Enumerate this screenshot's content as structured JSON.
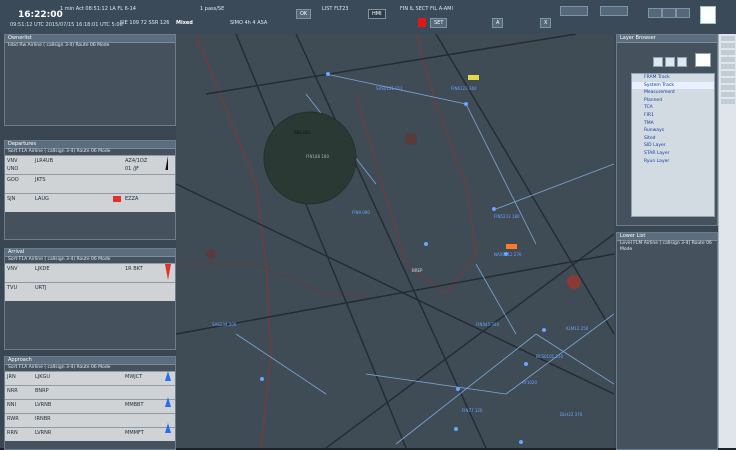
{
  "topbar": {
    "time": "16:22:00",
    "date": "09:51:12 UTC 2015/07/15 16:18:01 UTC 5:06",
    "group1a": "1 min Act   08:51:12  LA FL 6-14",
    "group1b": "SIE 109 72   SSR 126",
    "group1c": "Mixed",
    "group2a": "1 pass/SE   ",
    "group2b": "SIMO   4h  4 ASA",
    "group3a": "LIST FLT23",
    "group3b": "HMI",
    "group4a": "FIN   IL   SECT FIL   A-AMI",
    "btn_ok": "OK",
    "btn_set": "SET",
    "btn_a": "A",
    "btn_b": "X"
  },
  "left_panels": [
    {
      "header": "Ownerlist",
      "sub": "Inbd  Rw  Airline ( callsign 3-4)  Route 06 Mode",
      "rows": []
    },
    {
      "header": "Departures",
      "sub": "Sort  F1A  Airline ( callsign 3-4)  Route 06 Mode",
      "rows": [
        {
          "a": "VNV  ",
          "b": "UNO",
          "c": "JLR4UB",
          "d": "UNI   ",
          "e": "AZ4/1OZ",
          "f": "01 /JF"
        },
        {
          "a": "GOO  ",
          "b": "",
          "c": "JKTS",
          "d": "",
          "e": "",
          "f": ""
        },
        {
          "a": "SJN  ",
          "b": "",
          "c": "LAUG",
          "d": "",
          "e": "EZZA",
          "f": ""
        }
      ]
    },
    {
      "header": "Arrival",
      "sub": "Sort  F1A  Airline ( callsign 3-4)  Route 06 Mode",
      "rows": [
        {
          "a": "VNV  ",
          "b": "",
          "c": "LJKDE",
          "d": "",
          "e": "1R BKT",
          "f": ""
        },
        {
          "a": "TVU  ",
          "b": "",
          "c": "URTJ",
          "d": "",
          "e": "",
          "f": ""
        }
      ]
    },
    {
      "header": "Approach",
      "sub": "Sort  F1A  Airline ( callsign 3-4)  Route 06 Mode",
      "rows": [
        {
          "a": "JRN  ",
          "b": "",
          "c": "LJKGU",
          "d": "",
          "e": "MWJCT",
          "f": ""
        },
        {
          "a": "NRR  ",
          "b": "",
          "c": "BNRP",
          "d": "",
          "e": "",
          "f": ""
        },
        {
          "a": "NNI  ",
          "b": "",
          "c": "LVRNB",
          "d": "",
          "e": "MMBBT",
          "f": ""
        },
        {
          "a": "RWR  ",
          "b": "",
          "c": "IRNBR",
          "d": "",
          "e": "",
          "f": ""
        },
        {
          "a": "RRN  ",
          "b": "",
          "c": "LVRNR",
          "d": "",
          "e": "MMMFT",
          "f": ""
        },
        {
          "a": "ZNN  ",
          "b": "",
          "c": "ZCBCT",
          "d": "",
          "e": "",
          "f": ""
        }
      ]
    }
  ],
  "right": {
    "layer_header": "Layer Browser",
    "layer_items": [
      {
        "label": "FRAM Track",
        "hi": false
      },
      {
        "label": "System Track",
        "hi": true
      },
      {
        "label": "Measurement",
        "hi": false
      },
      {
        "label": "Planned",
        "hi": false
      },
      {
        "label": "TCA",
        "hi": false
      },
      {
        "label": "FIR1",
        "hi": false
      },
      {
        "label": "TMA",
        "hi": false
      },
      {
        "label": "Runways",
        "hi": false
      },
      {
        "label": "Sited",
        "hi": false
      },
      {
        "label": "SID Layer",
        "hi": false
      },
      {
        "label": "STAR Layer",
        "hi": false
      },
      {
        "label": "Ryun Layer",
        "hi": false
      }
    ],
    "lower_header": "Lower List",
    "lower_sub": "Level    FLM  Airline ( callsign 3-4)  Route 06 Mode"
  },
  "map": {
    "tags": [
      "SAS0121 F12",
      "FIN6123 360",
      "BEE 001",
      "FIN5233 180",
      "NAX0012 270",
      "SAS234 200",
      "FIN445 340",
      "KLM12 250",
      "AY1020",
      "FIN77 120",
      "BCS0101 210",
      "DLH22 370",
      "FIN9 090",
      "FIN188 180",
      "BREP"
    ]
  },
  "colors": {
    "map_bg": "#3f4b55",
    "track_blue": "#6aa6ff",
    "alarm_red": "#e01818",
    "sector_red": "#7a3a3a"
  }
}
